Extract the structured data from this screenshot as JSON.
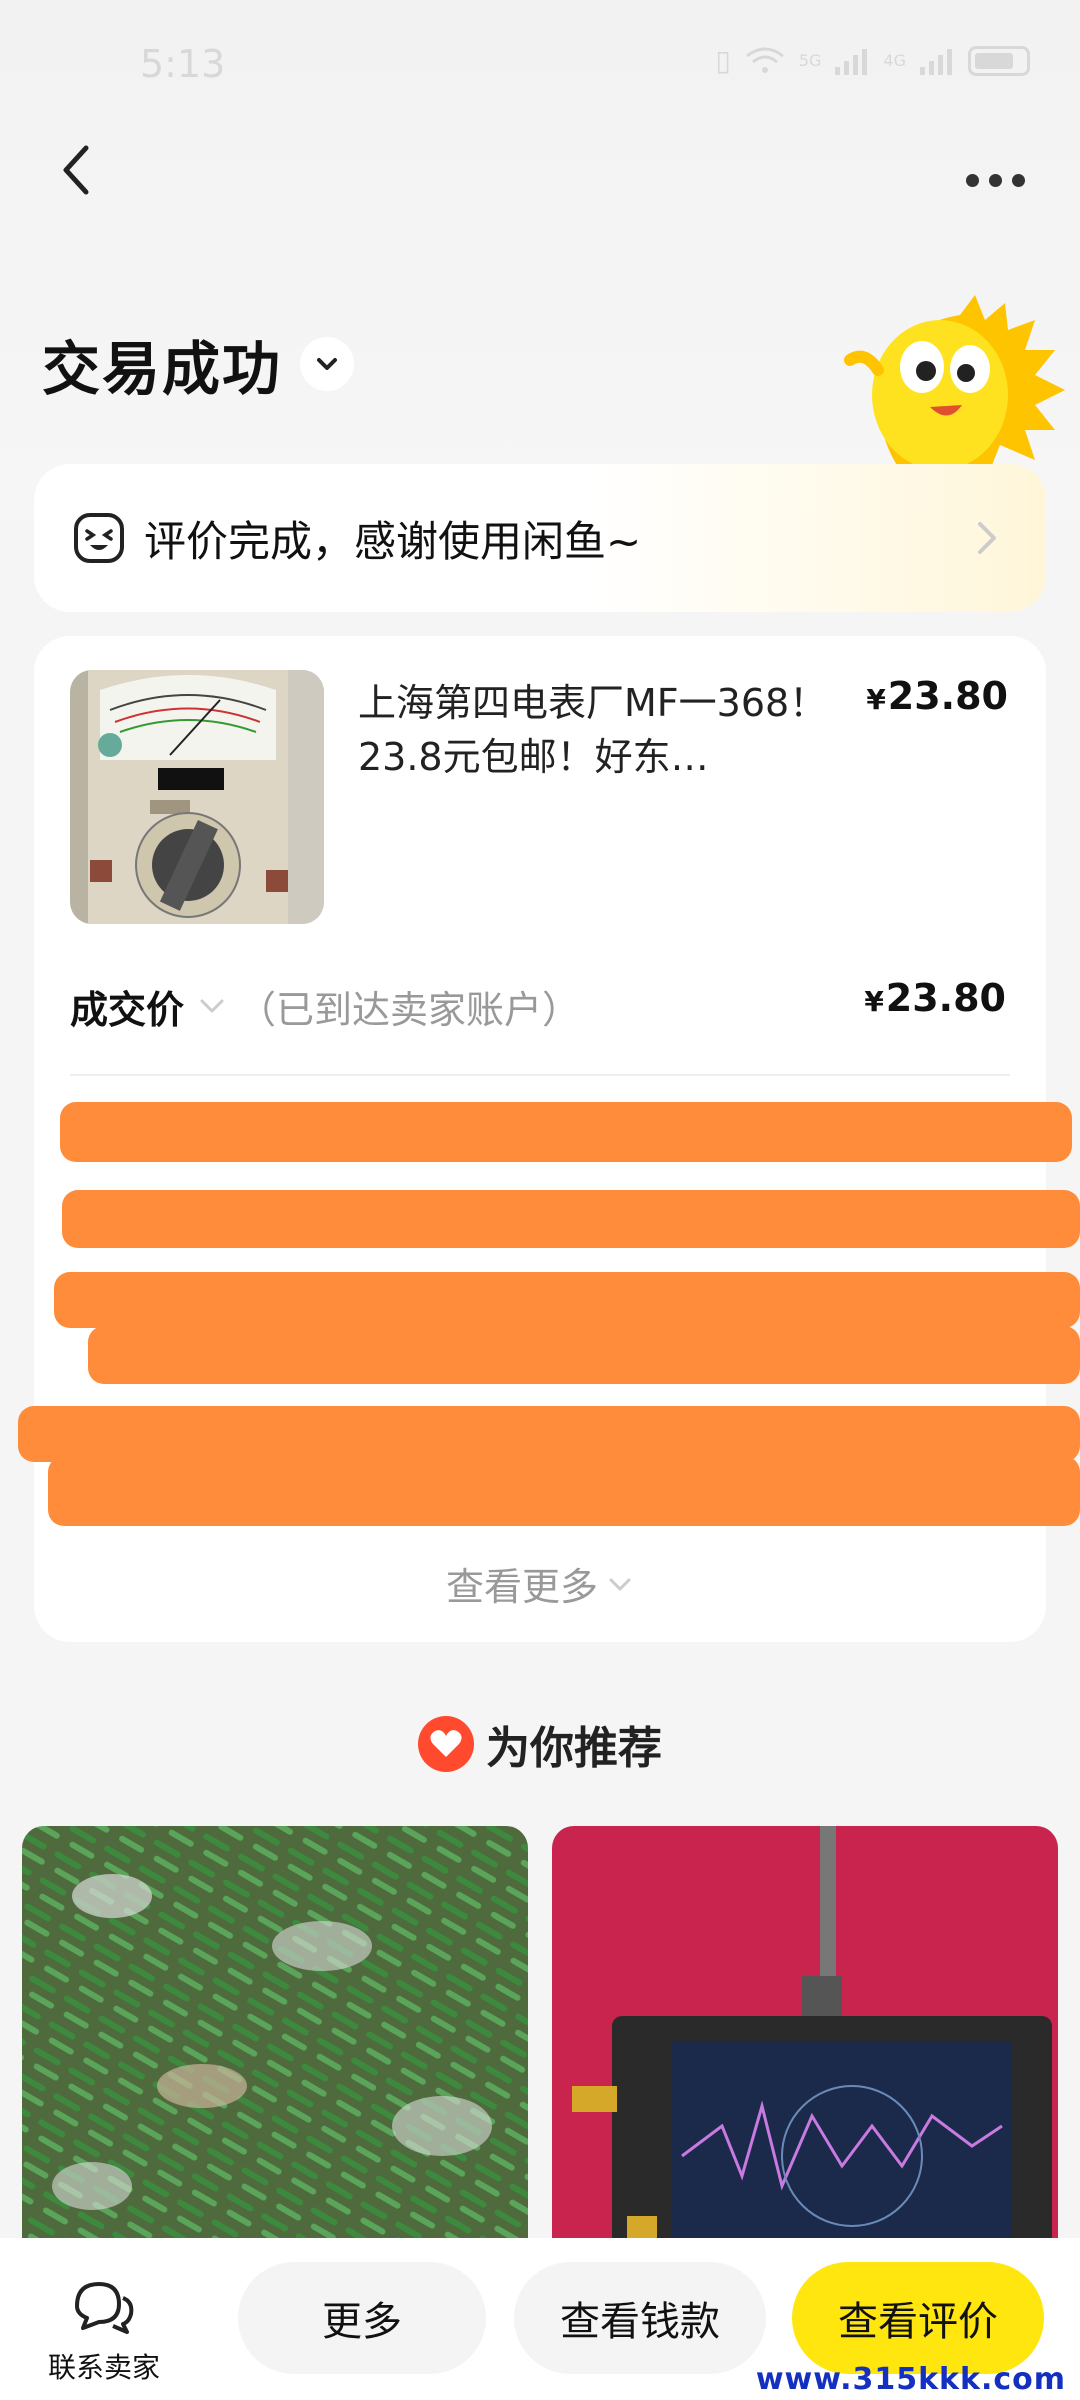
{
  "status_bar": {
    "time": "5:13",
    "network_1": "5G",
    "network_2": "4G"
  },
  "header": {
    "title": "交易成功"
  },
  "review_banner": {
    "text": "评价完成，感谢使用闲鱼~"
  },
  "order": {
    "product_title": "上海第四电表厂MF一368！23.8元包邮！好东…",
    "product_price_symbol": "¥",
    "product_price": "23.80",
    "deal_label": "成交价",
    "deal_note": "（已到达卖家账户）",
    "deal_price_symbol": "¥",
    "deal_price": "23.80",
    "see_more": "查看更多"
  },
  "recommend": {
    "title": "为你推荐"
  },
  "bottom_bar": {
    "contact_label": "联系卖家",
    "more_label": "更多",
    "money_label": "查看钱款",
    "review_label": "查看评价"
  },
  "watermark": "www.315kkk.com",
  "colors": {
    "accent_yellow": "#ffe60f",
    "redaction_orange": "#ff8c3a",
    "heart_red": "#ff4a2e"
  }
}
